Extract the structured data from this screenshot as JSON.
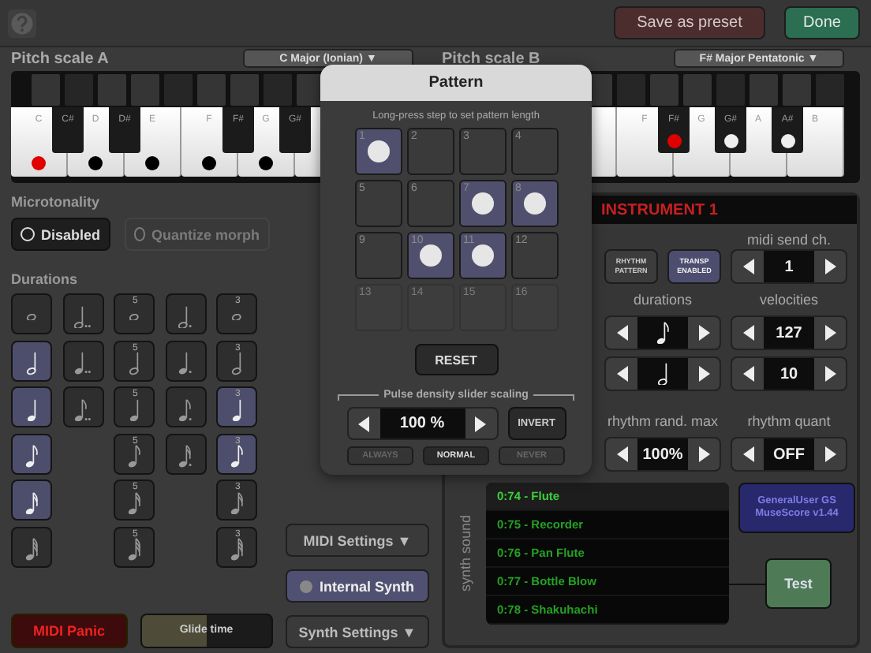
{
  "top_bar": {
    "buttons": [
      {
        "label": "Save as preset",
        "kind": "save"
      },
      {
        "label": "Done",
        "kind": "done"
      }
    ]
  },
  "pitch_scales": [
    {
      "label": "Pitch scale A",
      "scale": "C Major (Ionian) ▼",
      "keys": [
        {
          "kind": "white",
          "label": "C",
          "marked": true,
          "root": true
        },
        {
          "kind": "black",
          "label": "C#",
          "marked": false,
          "root": false
        },
        {
          "kind": "white",
          "label": "D",
          "marked": true,
          "root": false
        },
        {
          "kind": "black",
          "label": "D#",
          "marked": false,
          "root": false
        },
        {
          "kind": "white",
          "label": "E",
          "marked": true,
          "root": false
        },
        {
          "kind": "white",
          "label": "F",
          "marked": true,
          "root": false
        },
        {
          "kind": "black",
          "label": "F#",
          "marked": false,
          "root": false
        },
        {
          "kind": "white",
          "label": "G",
          "marked": true,
          "root": false
        },
        {
          "kind": "black",
          "label": "G#",
          "marked": false,
          "root": false
        },
        {
          "kind": "white"
        }
      ]
    },
    {
      "label": "Pitch scale B",
      "scale": "F# Major Pentatonic ▼",
      "keys": [
        {
          "kind": "white"
        },
        {
          "kind": "white",
          "label": "F",
          "marked": false,
          "root": false
        },
        {
          "kind": "black",
          "label": "F#",
          "marked": true,
          "root": true
        },
        {
          "kind": "white",
          "label": "G",
          "marked": false,
          "root": false
        },
        {
          "kind": "black",
          "label": "G#",
          "marked": true,
          "root": false
        },
        {
          "kind": "white",
          "label": "A",
          "marked": false,
          "root": false
        },
        {
          "kind": "black",
          "label": "A#",
          "marked": true,
          "root": false
        },
        {
          "kind": "white",
          "label": "B",
          "marked": false,
          "root": false
        }
      ]
    }
  ],
  "microtonality": {
    "label": "Microtonality",
    "options": [
      {
        "label": "Disabled",
        "disabled": false
      },
      {
        "label": "Quantize morph",
        "disabled": true
      }
    ]
  },
  "durations": {
    "label": "Durations",
    "cells": [
      [
        {
          "kind": "whole",
          "dotted": false,
          "double_dotted": false,
          "selected": false
        },
        {
          "kind": "half",
          "dotted": false,
          "double_dotted": true,
          "selected": false
        },
        {
          "kind": "whole",
          "dotted": false,
          "double_dotted": false,
          "tuplet": "5",
          "selected": false
        },
        {
          "kind": "half",
          "dotted": true,
          "double_dotted": false,
          "selected": false
        },
        {
          "kind": "whole",
          "dotted": false,
          "double_dotted": false,
          "tuplet": "3",
          "selected": false
        }
      ],
      [
        {
          "kind": "half",
          "dotted": false,
          "double_dotted": false,
          "selected": true
        },
        {
          "kind": "quarter",
          "dotted": false,
          "double_dotted": true,
          "selected": false
        },
        {
          "kind": "half",
          "dotted": false,
          "double_dotted": false,
          "tuplet": "5",
          "selected": false
        },
        {
          "kind": "quarter",
          "dotted": true,
          "double_dotted": false,
          "selected": false
        },
        {
          "kind": "half",
          "dotted": false,
          "double_dotted": false,
          "tuplet": "3",
          "selected": false
        }
      ],
      [
        {
          "kind": "quarter",
          "dotted": false,
          "double_dotted": false,
          "selected": true
        },
        {
          "kind": "eighth",
          "dotted": false,
          "double_dotted": true,
          "selected": false
        },
        {
          "kind": "quarter",
          "dotted": false,
          "double_dotted": false,
          "tuplet": "5",
          "selected": false
        },
        {
          "kind": "eighth",
          "dotted": true,
          "double_dotted": false,
          "selected": false
        },
        {
          "kind": "quarter",
          "dotted": false,
          "double_dotted": false,
          "tuplet": "3",
          "selected": true
        }
      ],
      [
        {
          "kind": "eighth",
          "dotted": false,
          "double_dotted": false,
          "selected": true
        },
        {
          "kind": "blank"
        },
        {
          "kind": "eighth",
          "dotted": false,
          "double_dotted": false,
          "tuplet": "5",
          "selected": false
        },
        {
          "kind": "sixteenth",
          "dotted": true,
          "double_dotted": false,
          "selected": false
        },
        {
          "kind": "eighth",
          "dotted": false,
          "double_dotted": false,
          "tuplet": "3",
          "selected": true
        }
      ],
      [
        {
          "kind": "sixteenth",
          "dotted": false,
          "double_dotted": false,
          "selected": true
        },
        {
          "kind": "blank"
        },
        {
          "kind": "sixteenth",
          "dotted": false,
          "double_dotted": false,
          "tuplet": "5",
          "selected": false
        },
        {
          "kind": "blank"
        },
        {
          "kind": "sixteenth",
          "dotted": false,
          "double_dotted": false,
          "tuplet": "3",
          "selected": false
        }
      ],
      [
        {
          "kind": "thirtysecond",
          "dotted": false,
          "double_dotted": false,
          "selected": false
        },
        {
          "kind": "blank"
        },
        {
          "kind": "thirtysecond",
          "dotted": false,
          "double_dotted": false,
          "tuplet": "5",
          "selected": false
        },
        {
          "kind": "blank"
        },
        {
          "kind": "thirtysecond",
          "dotted": false,
          "double_dotted": false,
          "tuplet": "3",
          "selected": false
        }
      ]
    ]
  },
  "bottom_left": {
    "panic": "MIDI Panic",
    "glide": {
      "label": "Glide time",
      "level": 0.5
    }
  },
  "middle_buttons": [
    {
      "label": "MIDI Settings ▼",
      "kind": "menu"
    },
    {
      "label": "Internal Synth",
      "kind": "toggle",
      "selected": true,
      "on": false
    },
    {
      "label": "Synth Settings ▼",
      "kind": "menu"
    }
  ],
  "instrument": {
    "title": "INSTRUMENT 1",
    "toggles": [
      {
        "label": "RHYTHM PATTERN",
        "on": false
      },
      {
        "label": "TRANSP ENABLED",
        "on": true
      }
    ],
    "midi_channel": {
      "label": "midi send ch.",
      "value": "1"
    },
    "columns": [
      {
        "label": "durations",
        "steppers": [
          {
            "kind": "eighth"
          },
          {
            "kind": "half"
          }
        ]
      },
      {
        "label": "velocities",
        "steppers": [
          {
            "kind": "value",
            "value": "127"
          },
          {
            "kind": "value",
            "value": "10"
          }
        ]
      },
      {
        "label": "rhythm rand. max",
        "steppers": [
          {
            "kind": "value",
            "value": "100%"
          }
        ]
      },
      {
        "label": "rhythm quant",
        "steppers": [
          {
            "kind": "value",
            "value": "OFF"
          }
        ]
      }
    ],
    "synth": {
      "label": "synth sound",
      "sounds": [
        {
          "label": "0:74 - Flute",
          "selected": true
        },
        {
          "label": "0:75 - Recorder",
          "selected": false
        },
        {
          "label": "0:76 - Pan Flute",
          "selected": false
        },
        {
          "label": "0:77 - Bottle Blow",
          "selected": false
        },
        {
          "label": "0:78 - Shakuhachi",
          "selected": false
        }
      ],
      "soundfont": "GeneralUser GS\nMuseScore v1.44",
      "test": "Test"
    }
  },
  "pattern": {
    "title": "Pattern",
    "hint": "Long-press step to set pattern length",
    "steps": [
      {
        "label": "1",
        "on": true,
        "disabled": false
      },
      {
        "label": "2",
        "on": false,
        "disabled": false
      },
      {
        "label": "3",
        "on": false,
        "disabled": false
      },
      {
        "label": "4",
        "on": false,
        "disabled": false
      },
      {
        "label": "5",
        "on": false,
        "disabled": false
      },
      {
        "label": "6",
        "on": false,
        "disabled": false
      },
      {
        "label": "7",
        "on": true,
        "disabled": false
      },
      {
        "label": "8",
        "on": true,
        "disabled": false
      },
      {
        "label": "9",
        "on": false,
        "disabled": false
      },
      {
        "label": "10",
        "on": true,
        "disabled": false
      },
      {
        "label": "11",
        "on": true,
        "disabled": false
      },
      {
        "label": "12",
        "on": false,
        "disabled": false
      },
      {
        "label": "13",
        "on": false,
        "disabled": true
      },
      {
        "label": "14",
        "on": false,
        "disabled": true
      },
      {
        "label": "15",
        "on": false,
        "disabled": true
      },
      {
        "label": "16",
        "on": false,
        "disabled": true
      }
    ],
    "reset": "RESET",
    "scaling": {
      "label": "Pulse density slider scaling",
      "value": "100 %",
      "invert": "INVERT",
      "modes": [
        {
          "label": "ALWAYS",
          "selected": false
        },
        {
          "label": "NORMAL",
          "selected": true
        },
        {
          "label": "NEVER",
          "selected": false
        }
      ]
    }
  }
}
